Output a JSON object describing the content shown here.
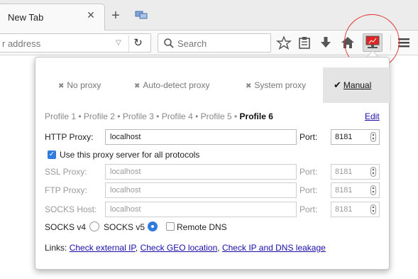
{
  "tab": {
    "title": "New Tab"
  },
  "urlbar": {
    "placeholder": "r address"
  },
  "searchbar": {
    "placeholder": "Search"
  },
  "modes": [
    {
      "label": "No proxy",
      "active": false
    },
    {
      "label": "Auto-detect proxy",
      "active": false
    },
    {
      "label": "System proxy",
      "active": false
    },
    {
      "label": "Manual",
      "active": true
    }
  ],
  "profiles": {
    "items": [
      "Profile 1",
      "Profile 2",
      "Profile 3",
      "Profile 4",
      "Profile 5"
    ],
    "separator": " • ",
    "current": "Profile 6",
    "edit_label": "Edit"
  },
  "http": {
    "label": "HTTP Proxy:",
    "host": "localhost",
    "port_label": "Port:",
    "port": "8181"
  },
  "use_for_all": {
    "label": "Use this proxy server for all protocols",
    "checked": true
  },
  "ssl": {
    "label": "SSL Proxy:",
    "host": "localhost",
    "port_label": "Port:",
    "port": "8181"
  },
  "ftp": {
    "label": "FTP Proxy:",
    "host": "localhost",
    "port_label": "Port:",
    "port": "8181"
  },
  "socks_host": {
    "label": "SOCKS Host:",
    "host": "localhost",
    "port_label": "Port:",
    "port": "8181"
  },
  "socks": {
    "v4_label": "SOCKS v4",
    "v5_label": "SOCKS v5",
    "selected": "v5",
    "remote_dns_label": "Remote DNS",
    "remote_dns": false
  },
  "links": {
    "prefix": "Links:",
    "items": [
      "Check external IP",
      "Check GEO location",
      "Check IP and DNS leakage"
    ],
    "sep": ","
  },
  "colors": {
    "accent": "#2f7ce0",
    "link": "#1a0dab",
    "highlight": "#e0322f"
  }
}
